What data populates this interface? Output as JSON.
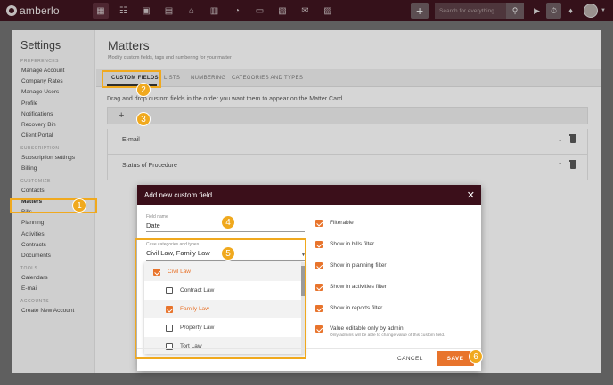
{
  "app": {
    "logo_text": "amberlo"
  },
  "topbar": {
    "search_placeholder": "Search for everything...",
    "nav_icons": [
      "dashboard-icon",
      "contacts-icon",
      "matters-icon",
      "documents-icon",
      "bank-icon",
      "calendar-icon",
      "time-icon",
      "folder-icon",
      "bills-icon",
      "mail-icon",
      "reports-icon"
    ]
  },
  "sidebar": {
    "title": "Settings",
    "sections": [
      {
        "name": "PREFERENCES",
        "items": [
          "Manage Account",
          "Company Rates",
          "Manage Users",
          "Profile",
          "Notifications",
          "Recovery Bin",
          "Client Portal"
        ]
      },
      {
        "name": "SUBSCRIPTION",
        "items": [
          "Subscription settings",
          "Billing"
        ]
      },
      {
        "name": "CUSTOMIZE",
        "items": [
          "Contacts",
          "Matters",
          "Bills",
          "Planning",
          "Activities",
          "Contracts",
          "Documents"
        ]
      },
      {
        "name": "TOOLS",
        "items": [
          "Calendars",
          "E-mail"
        ]
      },
      {
        "name": "ACCOUNTS",
        "items": [
          "Create New Account"
        ]
      }
    ],
    "active": "Matters"
  },
  "page": {
    "title": "Matters",
    "subtitle": "Modify custom fields, tags and numbering for your matter",
    "tabs": [
      "CUSTOM FIELDS",
      "LISTS",
      "NUMBERING",
      "CATEGORIES AND TYPES"
    ],
    "hint": "Drag and drop custom fields in the order you want them to appear on the Matter Card",
    "add_label": "+",
    "fields": [
      {
        "label": "E-mail",
        "arrow": "↓"
      },
      {
        "label": "Status of Procedure",
        "arrow": "↑"
      }
    ]
  },
  "modal": {
    "title": "Add new custom field",
    "close": "✕",
    "field_name_label": "Field name",
    "field_name_value": "Date",
    "case_label": "Case categories and types",
    "case_value": "Civil Law, Family Law",
    "dropdown": [
      {
        "label": "Civil Law",
        "checked": true,
        "indent": false,
        "on": true
      },
      {
        "label": "Contract Law",
        "checked": false,
        "indent": true,
        "on": false
      },
      {
        "label": "Family Law",
        "checked": true,
        "indent": true,
        "on": true
      },
      {
        "label": "Property Law",
        "checked": false,
        "indent": true,
        "on": false
      },
      {
        "label": "Tort Law",
        "checked": false,
        "indent": true,
        "on": false
      }
    ],
    "options": [
      {
        "label": "Filterable"
      },
      {
        "label": "Show in bills filter"
      },
      {
        "label": "Show in planning filter"
      },
      {
        "label": "Show in activities filter"
      },
      {
        "label": "Show in reports filter"
      },
      {
        "label": "Value editable only by admin",
        "note": "Only admins will be able to change value of this custom field."
      }
    ],
    "cancel_label": "CANCEL",
    "save_label": "SAVE"
  },
  "callouts": [
    "1",
    "2",
    "3",
    "4",
    "5",
    "6"
  ],
  "colors": {
    "navbar": "#3b0f1a",
    "accent": "#e8742c",
    "callout": "#f0a91e"
  }
}
